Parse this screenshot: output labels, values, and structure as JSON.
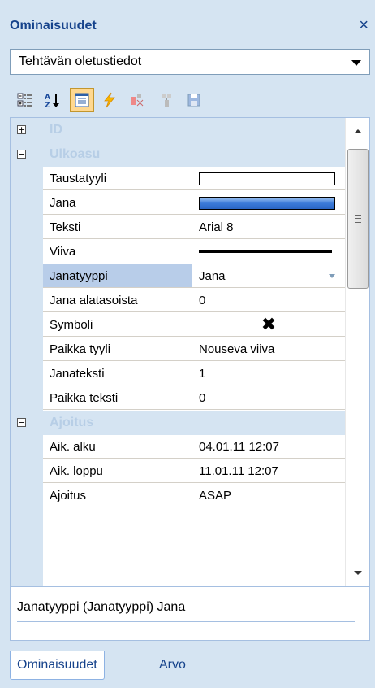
{
  "panel": {
    "title": "Ominaisuudet",
    "close_glyph": "×"
  },
  "object_selector": {
    "value": "Tehtävän oletustiedot"
  },
  "toolbar": {
    "buttons": [
      {
        "icon": "categorized-icon"
      },
      {
        "icon": "sort-alphabetical-icon"
      },
      {
        "icon": "properties-icon",
        "active": true
      },
      {
        "icon": "events-lightning-icon"
      },
      {
        "icon": "cut-icon"
      },
      {
        "icon": "paste-icon"
      },
      {
        "icon": "save-icon"
      }
    ]
  },
  "grid": {
    "categories": [
      {
        "label": "ID",
        "toggle": "+"
      },
      {
        "label": "Ulkoasu",
        "toggle": "−"
      },
      {
        "label": "Ajoitus",
        "toggle": "−"
      }
    ],
    "rows": [
      {
        "name": "Taustatyyli",
        "value": ""
      },
      {
        "name": "Jana",
        "value": ""
      },
      {
        "name": "Teksti",
        "value": "Arial 8"
      },
      {
        "name": "Viiva",
        "value": ""
      },
      {
        "name": "Janatyyppi",
        "value": "Jana"
      },
      {
        "name": "Jana alatasoista",
        "value": "0"
      },
      {
        "name": "Symboli",
        "value": "✖"
      },
      {
        "name": "Paikka tyyli",
        "value": "Nouseva viiva"
      },
      {
        "name": "Janateksti",
        "value": "1"
      },
      {
        "name": "Paikka teksti",
        "value": "0"
      },
      {
        "name": "Aik. alku",
        "value": "04.01.11 12:07"
      },
      {
        "name": "Aik. loppu",
        "value": "11.01.11 12:07"
      },
      {
        "name": "Ajoitus",
        "value": "ASAP"
      }
    ],
    "selected_row": "Janatyyppi"
  },
  "description": {
    "text": "Janatyyppi (Janatyyppi) Jana"
  },
  "tabs": [
    {
      "label": "Ominaisuudet",
      "active": true
    },
    {
      "label": "Arvo",
      "active": false
    }
  ],
  "colors": {
    "panel_bg": "#d5e4f2",
    "title_text": "#15428b",
    "category_text": "#b7cee6",
    "selected_row": "#b8cde9",
    "jana_swatch": "#3b7ad8"
  }
}
